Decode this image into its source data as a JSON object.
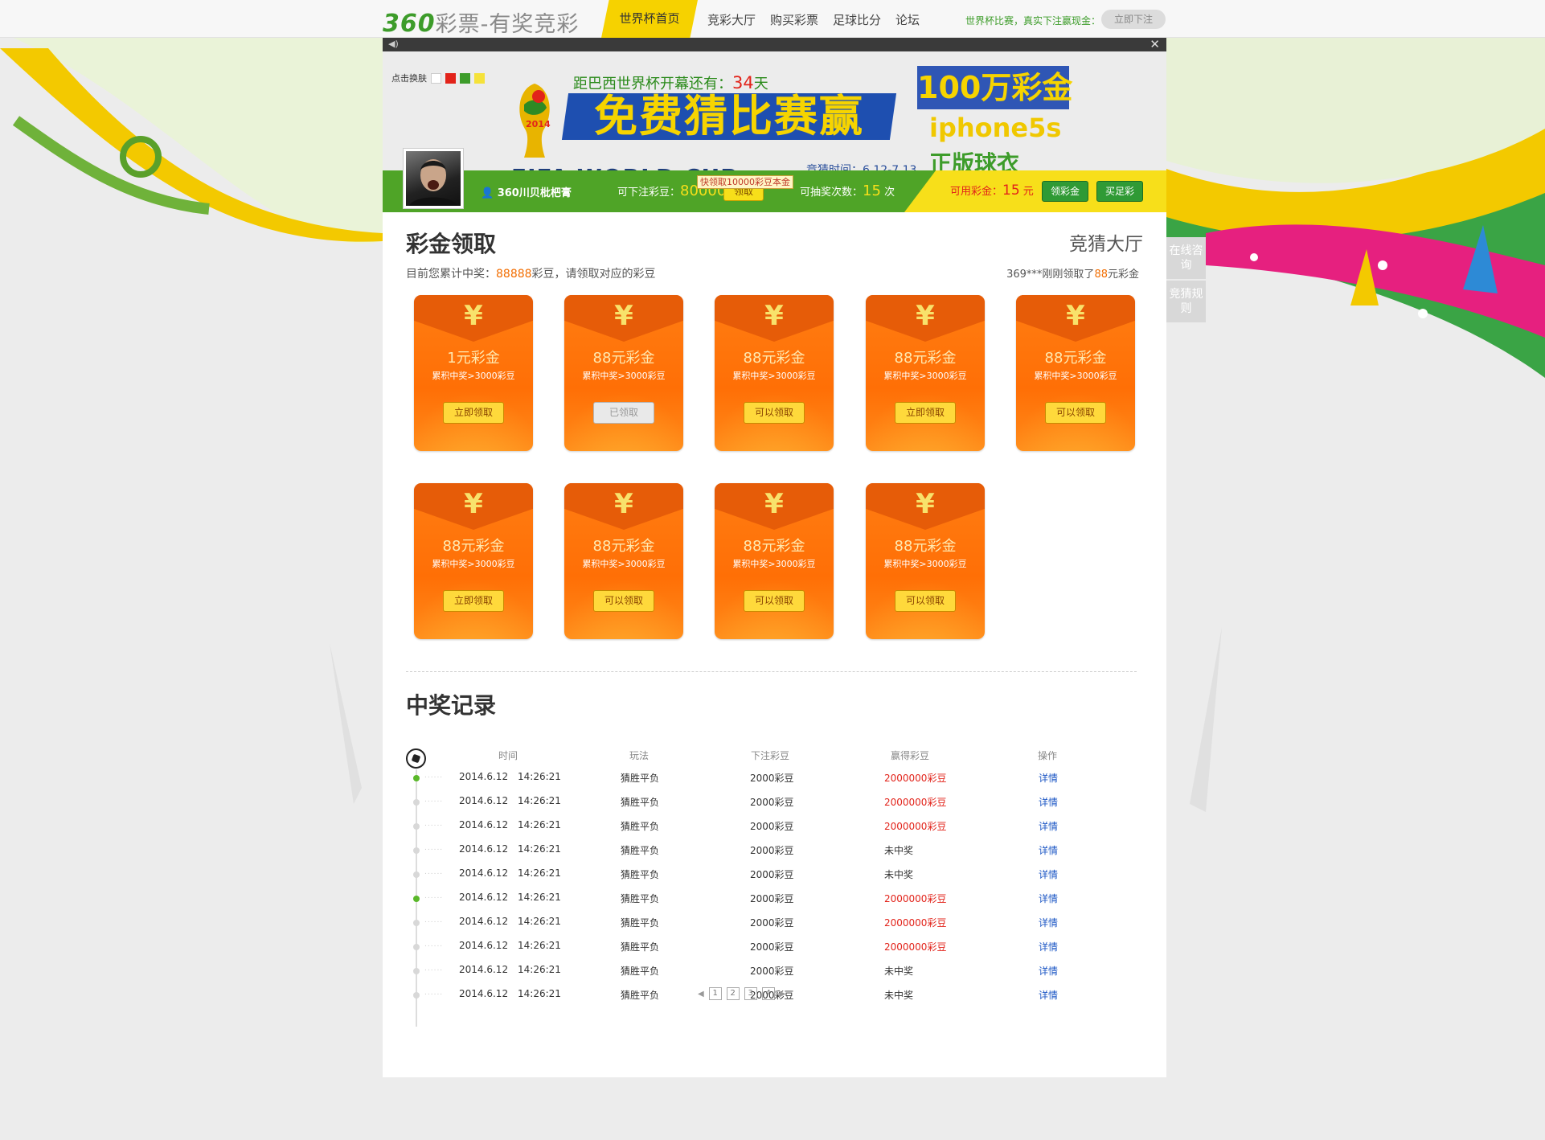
{
  "nav": {
    "logo_num": "360",
    "logo_text": "彩票-有奖竞彩",
    "home": "世界杯首页",
    "links": [
      "竞彩大厅",
      "购买彩票",
      "足球比分",
      "论坛"
    ],
    "promo": "世界杯比赛，真实下注赢现金：",
    "bet_button": "立即下注"
  },
  "banner": {
    "skin_label": "点击换肤",
    "skin_colors": [
      "#ffffff",
      "#e2231a",
      "#3d9c2a",
      "#f5e23a"
    ],
    "countdown_prefix": "距巴西世界杯开幕还有：",
    "countdown_days": "34",
    "countdown_suffix": "天",
    "slogan": "免费猜比赛赢",
    "prize1": "100万彩金",
    "prize2": "iphone5s",
    "prize3": "正版球衣",
    "guess_time": "竞猜时间：6.12-7.13",
    "fifa": "FIFA WORLD CUP",
    "trophy_year": "2014",
    "tip": "快领取10000彩豆本金"
  },
  "status": {
    "username": "360川贝枇杷膏",
    "bet_label": "可下注彩豆：",
    "bet_value": "80000",
    "claim_button": "领取",
    "draw_label": "可抽奖次数：",
    "draw_value": "15",
    "draw_unit": "次",
    "cash_label": "可用彩金：",
    "cash_value": "15",
    "cash_unit": "元",
    "get_cash_button": "领彩金",
    "buy_lottery_button": "买足彩"
  },
  "claim": {
    "title": "彩金领取",
    "hall_link": "竞猜大厅",
    "note_prefix": "目前您累计中奖：",
    "note_amount": "88888",
    "note_suffix": "彩豆，请领取对应的彩豆",
    "right_note_prefix": "369***刚刚领取了",
    "right_note_amount": "88",
    "right_note_suffix": "元彩金",
    "cards": [
      {
        "amount": "1元彩金",
        "cond": "累积中奖>3000彩豆",
        "button": "立即领取",
        "state": "active"
      },
      {
        "amount": "88元彩金",
        "cond": "累积中奖>3000彩豆",
        "button": "已领取",
        "state": "done"
      },
      {
        "amount": "88元彩金",
        "cond": "累积中奖>3000彩豆",
        "button": "可以领取",
        "state": "active"
      },
      {
        "amount": "88元彩金",
        "cond": "累积中奖>3000彩豆",
        "button": "立即领取",
        "state": "active"
      },
      {
        "amount": "88元彩金",
        "cond": "累积中奖>3000彩豆",
        "button": "可以领取",
        "state": "active"
      },
      {
        "amount": "88元彩金",
        "cond": "累积中奖>3000彩豆",
        "button": "立即领取",
        "state": "active"
      },
      {
        "amount": "88元彩金",
        "cond": "累积中奖>3000彩豆",
        "button": "可以领取",
        "state": "active"
      },
      {
        "amount": "88元彩金",
        "cond": "累积中奖>3000彩豆",
        "button": "可以领取",
        "state": "active"
      },
      {
        "amount": "88元彩金",
        "cond": "累积中奖>3000彩豆",
        "button": "可以领取",
        "state": "active"
      }
    ]
  },
  "records": {
    "title": "中奖记录",
    "headers": [
      "时间",
      "玩法",
      "下注彩豆",
      "赢得彩豆",
      "操作"
    ],
    "rows": [
      {
        "date": "2014.6.12",
        "time": "14:26:21",
        "play": "猜胜平负",
        "bet": "2000彩豆",
        "won": "2000000彩豆",
        "win": true,
        "active": true,
        "action": "详情"
      },
      {
        "date": "2014.6.12",
        "time": "14:26:21",
        "play": "猜胜平负",
        "bet": "2000彩豆",
        "won": "2000000彩豆",
        "win": true,
        "active": false,
        "action": "详情"
      },
      {
        "date": "2014.6.12",
        "time": "14:26:21",
        "play": "猜胜平负",
        "bet": "2000彩豆",
        "won": "2000000彩豆",
        "win": true,
        "active": false,
        "action": "详情"
      },
      {
        "date": "2014.6.12",
        "time": "14:26:21",
        "play": "猜胜平负",
        "bet": "2000彩豆",
        "won": "未中奖",
        "win": false,
        "active": false,
        "action": "详情"
      },
      {
        "date": "2014.6.12",
        "time": "14:26:21",
        "play": "猜胜平负",
        "bet": "2000彩豆",
        "won": "未中奖",
        "win": false,
        "active": false,
        "action": "详情"
      },
      {
        "date": "2014.6.12",
        "time": "14:26:21",
        "play": "猜胜平负",
        "bet": "2000彩豆",
        "won": "2000000彩豆",
        "win": true,
        "active": true,
        "action": "详情"
      },
      {
        "date": "2014.6.12",
        "time": "14:26:21",
        "play": "猜胜平负",
        "bet": "2000彩豆",
        "won": "2000000彩豆",
        "win": true,
        "active": false,
        "action": "详情"
      },
      {
        "date": "2014.6.12",
        "time": "14:26:21",
        "play": "猜胜平负",
        "bet": "2000彩豆",
        "won": "2000000彩豆",
        "win": true,
        "active": false,
        "action": "详情"
      },
      {
        "date": "2014.6.12",
        "time": "14:26:21",
        "play": "猜胜平负",
        "bet": "2000彩豆",
        "won": "未中奖",
        "win": false,
        "active": false,
        "action": "详情"
      },
      {
        "date": "2014.6.12",
        "time": "14:26:21",
        "play": "猜胜平负",
        "bet": "2000彩豆",
        "won": "未中奖",
        "win": false,
        "active": false,
        "action": "详情"
      }
    ],
    "pages": [
      "1",
      "2",
      "3",
      "4"
    ]
  },
  "side": {
    "tabs": [
      "在线咨询",
      "竞猜规则"
    ]
  }
}
